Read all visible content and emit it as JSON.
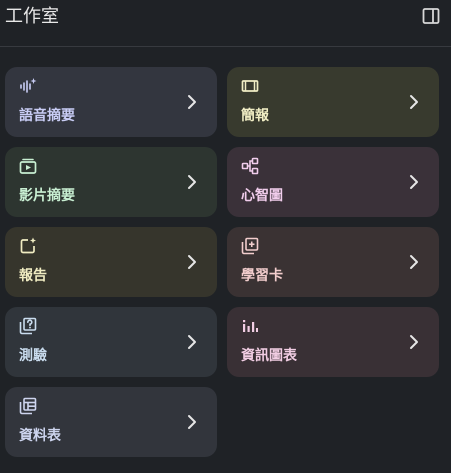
{
  "header": {
    "title": "工作室"
  },
  "cards": [
    {
      "label": "語音摘要",
      "icon": "audio-waveform-sparkle-icon",
      "bg": "#33363f",
      "accent": "#c9cdf5"
    },
    {
      "label": "簡報",
      "icon": "slides-icon",
      "bg": "#383a2e",
      "accent": "#f0edc4"
    },
    {
      "label": "影片摘要",
      "icon": "video-play-icon",
      "bg": "#2d3530",
      "accent": "#c8efd2"
    },
    {
      "label": "心智圖",
      "icon": "mind-map-icon",
      "bg": "#3a3139",
      "accent": "#f1cdec"
    },
    {
      "label": "報告",
      "icon": "report-sparkle-icon",
      "bg": "#36352c",
      "accent": "#f0ecc2"
    },
    {
      "label": "學習卡",
      "icon": "flashcards-icon",
      "bg": "#3a3233",
      "accent": "#f2cdcd"
    },
    {
      "label": "測驗",
      "icon": "quiz-icon",
      "bg": "#30353b",
      "accent": "#c9dcee"
    },
    {
      "label": "資訊圖表",
      "icon": "infographic-icon",
      "bg": "#393035",
      "accent": "#f1cde3"
    },
    {
      "label": "資料表",
      "icon": "data-table-icon",
      "bg": "#32353c",
      "accent": "#cdd4ee"
    }
  ]
}
